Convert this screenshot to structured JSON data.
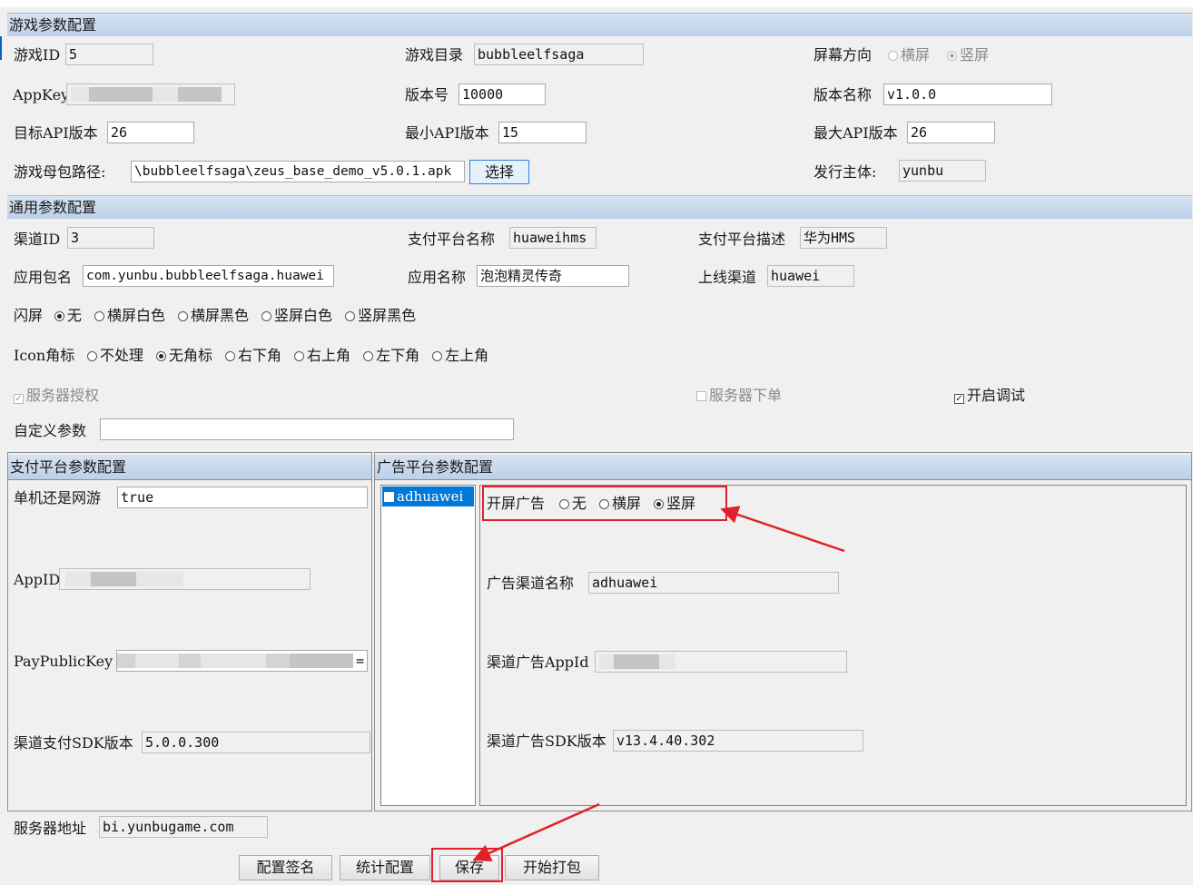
{
  "game_section": {
    "title": "游戏参数配置",
    "game_id_label": "游戏ID",
    "game_id_value": "5",
    "game_dir_label": "游戏目录",
    "game_dir_value": "bubbleelfsaga",
    "orientation_label": "屏幕方向",
    "orientation_options": [
      "横屏",
      "竖屏"
    ],
    "orientation_selected": "竖屏",
    "appkey_label": "AppKey",
    "version_code_label": "版本号",
    "version_code_value": "10000",
    "version_name_label": "版本名称",
    "version_name_value": "v1.0.0",
    "target_api_label": "目标API版本",
    "target_api_value": "26",
    "min_api_label": "最小API版本",
    "min_api_value": "15",
    "max_api_label": "最大API版本",
    "max_api_value": "26",
    "apk_path_label": "游戏母包路径:",
    "apk_path_value": "\\bubbleelfsaga\\zeus_base_demo_v5.0.1.apk",
    "choose_button": "选择",
    "publisher_label": "发行主体:",
    "publisher_value": "yunbu"
  },
  "common_section": {
    "title": "通用参数配置",
    "channel_id_label": "渠道ID",
    "channel_id_value": "3",
    "pay_name_label": "支付平台名称",
    "pay_name_value": "huaweihms",
    "pay_desc_label": "支付平台描述",
    "pay_desc_value": "华为HMS",
    "package_label": "应用包名",
    "package_value": "com.yunbu.bubbleelfsaga.huawei",
    "app_name_label": "应用名称",
    "app_name_value": "泡泡精灵传奇",
    "online_channel_label": "上线渠道",
    "online_channel_value": "huawei",
    "splash_label": "闪屏",
    "splash_options": [
      "无",
      "横屏白色",
      "横屏黑色",
      "竖屏白色",
      "竖屏黑色"
    ],
    "splash_selected": "无",
    "icon_label": "Icon角标",
    "icon_options": [
      "不处理",
      "无角标",
      "右下角",
      "右上角",
      "左下角",
      "左上角"
    ],
    "icon_selected": "无角标",
    "server_auth_label": "服务器授权",
    "server_auth_checked": true,
    "server_order_label": "服务器下单",
    "server_order_checked": false,
    "debug_label": "开启调试",
    "debug_checked": true,
    "custom_params_label": "自定义参数",
    "custom_params_value": ""
  },
  "pay_panel": {
    "title": "支付平台参数配置",
    "mode_label": "单机还是网游",
    "mode_value": "true",
    "appid_label": "AppID",
    "pubkey_label": "PayPublicKey",
    "pubkey_tail": "=",
    "sdk_version_label": "渠道支付SDK版本",
    "sdk_version_value": "5.0.0.300"
  },
  "ad_panel": {
    "title": "广告平台参数配置",
    "list_items": [
      {
        "label": "adhuawei",
        "checked": false
      }
    ],
    "splash_ad_label": "开屏广告",
    "splash_ad_options": [
      "无",
      "横屏",
      "竖屏"
    ],
    "splash_ad_selected": "竖屏",
    "ad_channel_label": "广告渠道名称",
    "ad_channel_value": "adhuawei",
    "ad_appid_label": "渠道广告AppId",
    "ad_sdk_label": "渠道广告SDK版本",
    "ad_sdk_value": "v13.4.40.302"
  },
  "footer": {
    "server_addr_label": "服务器地址",
    "server_addr_value": "bi.yunbugame.com",
    "buttons": [
      "配置签名",
      "统计配置",
      "保存",
      "开始打包"
    ]
  },
  "colors": {
    "section_header": "#c8d9ee",
    "highlight_red": "#e0202a",
    "selection_blue": "#0078d7"
  }
}
